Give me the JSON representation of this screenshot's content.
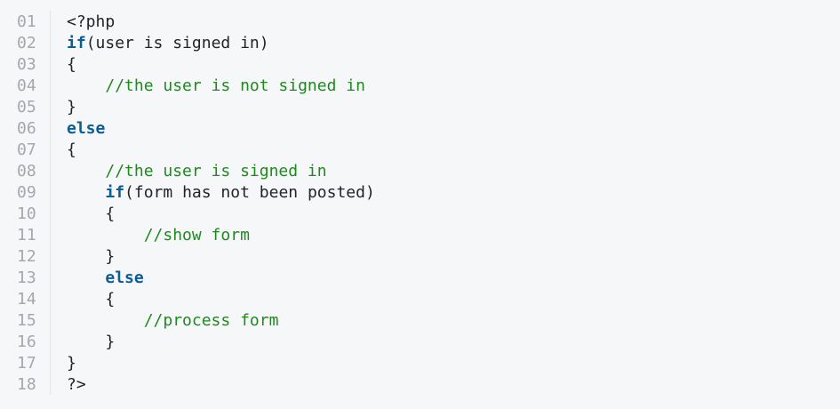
{
  "colors": {
    "background": "#f6f7f9",
    "line_number": "#a3a8ae",
    "keyword": "#0b5d94",
    "comment": "#1e8a1e",
    "text": "#1f2328"
  },
  "code": {
    "lines": [
      {
        "num": "01",
        "pre": "",
        "tok": "",
        "post": "<?php",
        "kind": "plain"
      },
      {
        "num": "02",
        "pre": "",
        "tok": "if",
        "post": "(user is signed in)",
        "kind": "keyword"
      },
      {
        "num": "03",
        "pre": "",
        "tok": "",
        "post": "{",
        "kind": "plain"
      },
      {
        "num": "04",
        "pre": "    ",
        "tok": "//the user is not signed in",
        "post": "",
        "kind": "comment"
      },
      {
        "num": "05",
        "pre": "",
        "tok": "",
        "post": "}",
        "kind": "plain"
      },
      {
        "num": "06",
        "pre": "",
        "tok": "else",
        "post": "",
        "kind": "keyword"
      },
      {
        "num": "07",
        "pre": "",
        "tok": "",
        "post": "{",
        "kind": "plain"
      },
      {
        "num": "08",
        "pre": "    ",
        "tok": "//the user is signed in",
        "post": "",
        "kind": "comment"
      },
      {
        "num": "09",
        "pre": "    ",
        "tok": "if",
        "post": "(form has not been posted)",
        "kind": "keyword"
      },
      {
        "num": "10",
        "pre": "    ",
        "tok": "",
        "post": "{",
        "kind": "plain"
      },
      {
        "num": "11",
        "pre": "        ",
        "tok": "//show form",
        "post": "",
        "kind": "comment"
      },
      {
        "num": "12",
        "pre": "    ",
        "tok": "",
        "post": "}",
        "kind": "plain"
      },
      {
        "num": "13",
        "pre": "    ",
        "tok": "else",
        "post": "",
        "kind": "keyword"
      },
      {
        "num": "14",
        "pre": "    ",
        "tok": "",
        "post": "{",
        "kind": "plain"
      },
      {
        "num": "15",
        "pre": "        ",
        "tok": "//process form",
        "post": "",
        "kind": "comment"
      },
      {
        "num": "16",
        "pre": "    ",
        "tok": "",
        "post": "}",
        "kind": "plain"
      },
      {
        "num": "17",
        "pre": "",
        "tok": "",
        "post": "}",
        "kind": "plain"
      },
      {
        "num": "18",
        "pre": "",
        "tok": "",
        "post": "?>",
        "kind": "plain"
      }
    ]
  }
}
